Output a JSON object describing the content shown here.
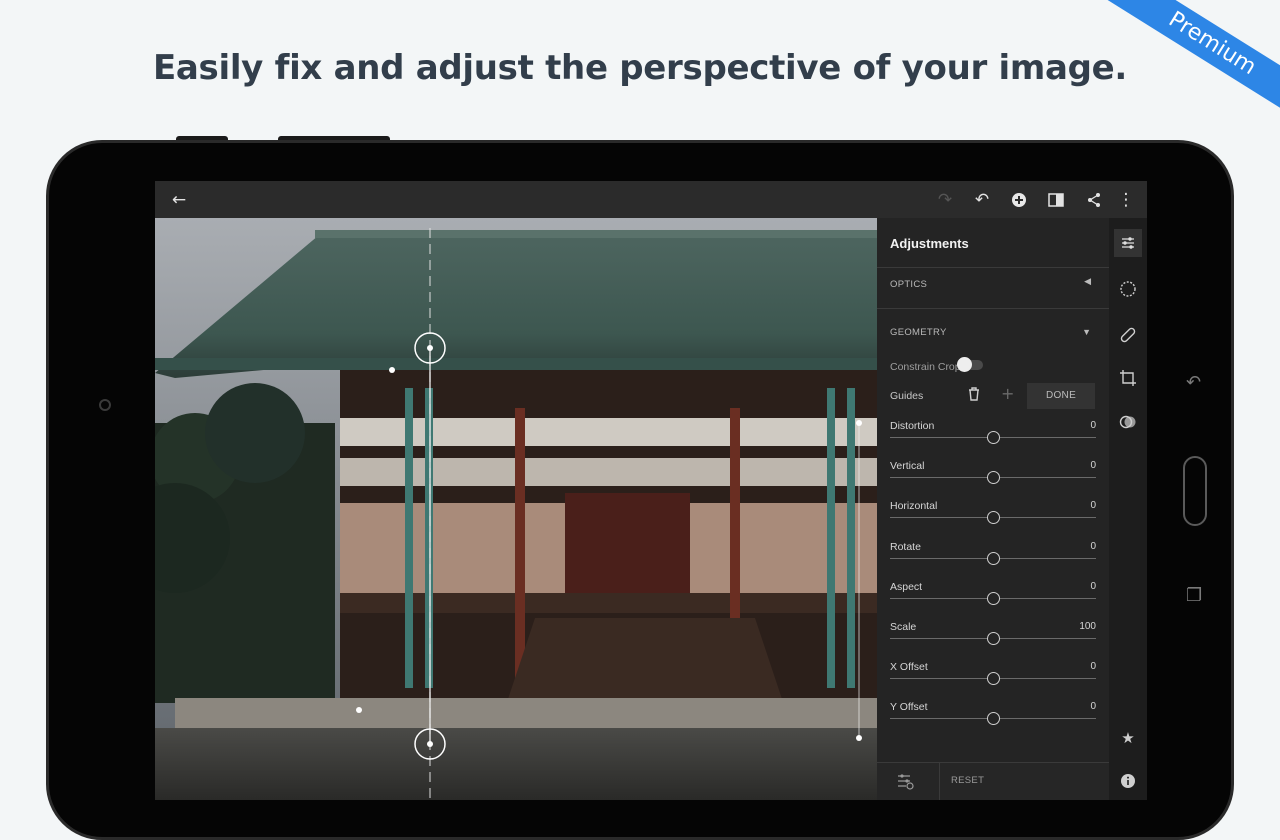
{
  "promo": {
    "headline": "Easily fix and adjust the perspective of your image.",
    "ribbon": "Premium"
  },
  "topbar": {
    "icons": [
      "back-arrow-icon",
      "redo-icon",
      "undo-icon",
      "add-icon",
      "compare-icon",
      "share-icon",
      "more-icon"
    ]
  },
  "panel": {
    "title": "Adjustments",
    "sections": {
      "optics": "OPTICS",
      "geometry": "GEOMETRY"
    },
    "constrain_crop_label": "Constrain Crop",
    "constrain_crop_on": false,
    "guides_label": "Guides",
    "done_label": "DONE",
    "sliders": [
      {
        "name": "Distortion",
        "value": "0",
        "fraction": 0.5
      },
      {
        "name": "Vertical",
        "value": "0",
        "fraction": 0.5
      },
      {
        "name": "Horizontal",
        "value": "0",
        "fraction": 0.5
      },
      {
        "name": "Rotate",
        "value": "0",
        "fraction": 0.5
      },
      {
        "name": "Aspect",
        "value": "0",
        "fraction": 0.5
      },
      {
        "name": "Scale",
        "value": "100",
        "fraction": 0.5
      },
      {
        "name": "X Offset",
        "value": "0",
        "fraction": 0.5
      },
      {
        "name": "Y Offset",
        "value": "0",
        "fraction": 0.5
      }
    ],
    "reset_label": "RESET"
  },
  "rail": {
    "icons": [
      "adjustments-icon",
      "selective-icon",
      "healing-icon",
      "crop-icon",
      "presets-icon",
      "star-icon",
      "info-icon"
    ]
  },
  "colors": {
    "ribbon": "#2d86e6",
    "headline": "#323e4b",
    "roof": "#3f5d55",
    "wood": "#5a2d22",
    "teal_pillar": "#3f7872"
  }
}
